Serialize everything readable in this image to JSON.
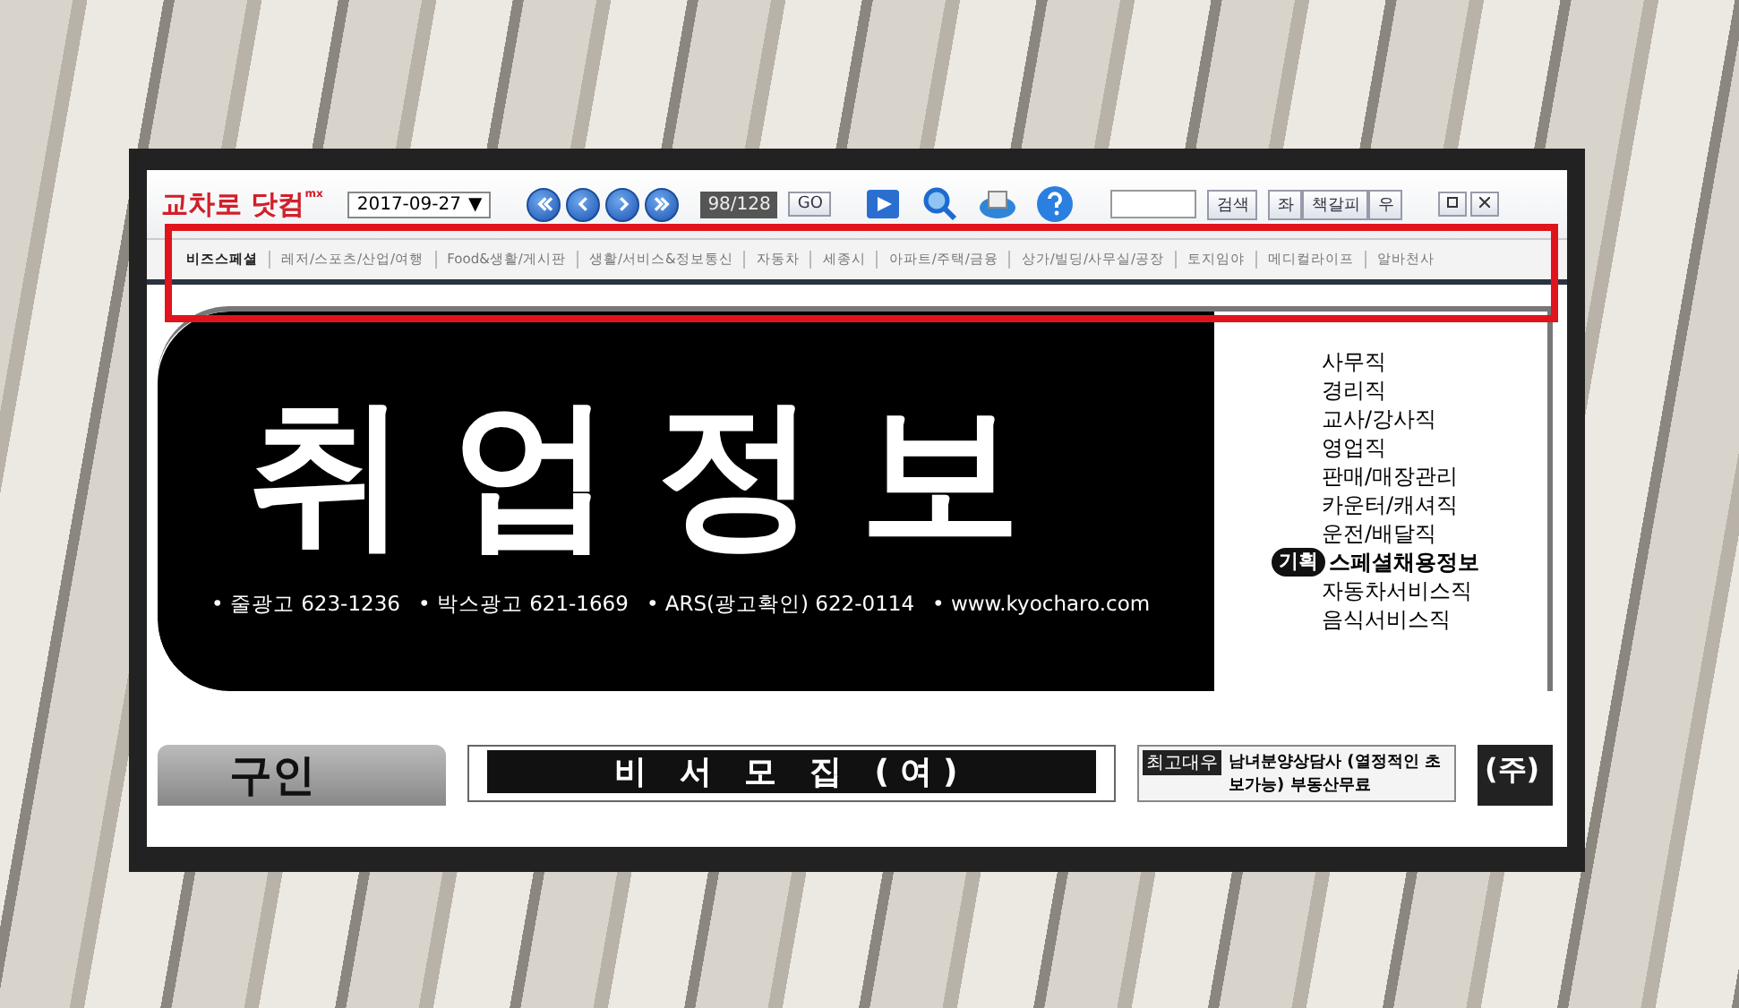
{
  "toolbar": {
    "logo": "교차로 닷컴",
    "logo_badge": "mx",
    "date": "2017-09-27",
    "date_caret": "▼",
    "page_counter": "98/128",
    "go_button": "GO",
    "search_button": "검색",
    "bookmark_left": "좌",
    "bookmark_label": "책갈피",
    "bookmark_right": "우"
  },
  "categories": [
    {
      "label": "비즈스페셜",
      "selected": true
    },
    {
      "label": "레저/스포츠/산업/여행",
      "selected": false
    },
    {
      "label": "Food&생활/게시판",
      "selected": false
    },
    {
      "label": "생활/서비스&정보통신",
      "selected": false
    },
    {
      "label": "자동차",
      "selected": false
    },
    {
      "label": "세종시",
      "selected": false
    },
    {
      "label": "아파트/주택/금융",
      "selected": false
    },
    {
      "label": "상가/빌딩/사무실/공장",
      "selected": false
    },
    {
      "label": "토지임야",
      "selected": false
    },
    {
      "label": "메디컬라이프",
      "selected": false
    },
    {
      "label": "알바천사",
      "selected": false
    }
  ],
  "banner": {
    "title": "취업정보",
    "contacts": [
      "• 줄광고 623-1236",
      "• 박스광고 621-1669",
      "• ARS(광고확인) 622-0114",
      "• www.kyocharo.com"
    ],
    "jobs": [
      {
        "label": "사무직"
      },
      {
        "label": "경리직"
      },
      {
        "label": "교사/강사직"
      },
      {
        "label": "영업직"
      },
      {
        "label": "판매/매장관리"
      },
      {
        "label": "카운터/캐셔직"
      },
      {
        "label": "운전/배달직"
      },
      {
        "label": "스페셜채용정보",
        "tag": "기획"
      },
      {
        "label": "자동차서비스직"
      },
      {
        "label": "음식서비스직"
      }
    ]
  },
  "ads": {
    "left": "구인",
    "middle": "비 서 모 집 (여)",
    "right_tag": "최고대우",
    "right_text": "남녀분양상담사 (열정적인 초보가능) 부동산무료",
    "far_right": "(주)"
  }
}
